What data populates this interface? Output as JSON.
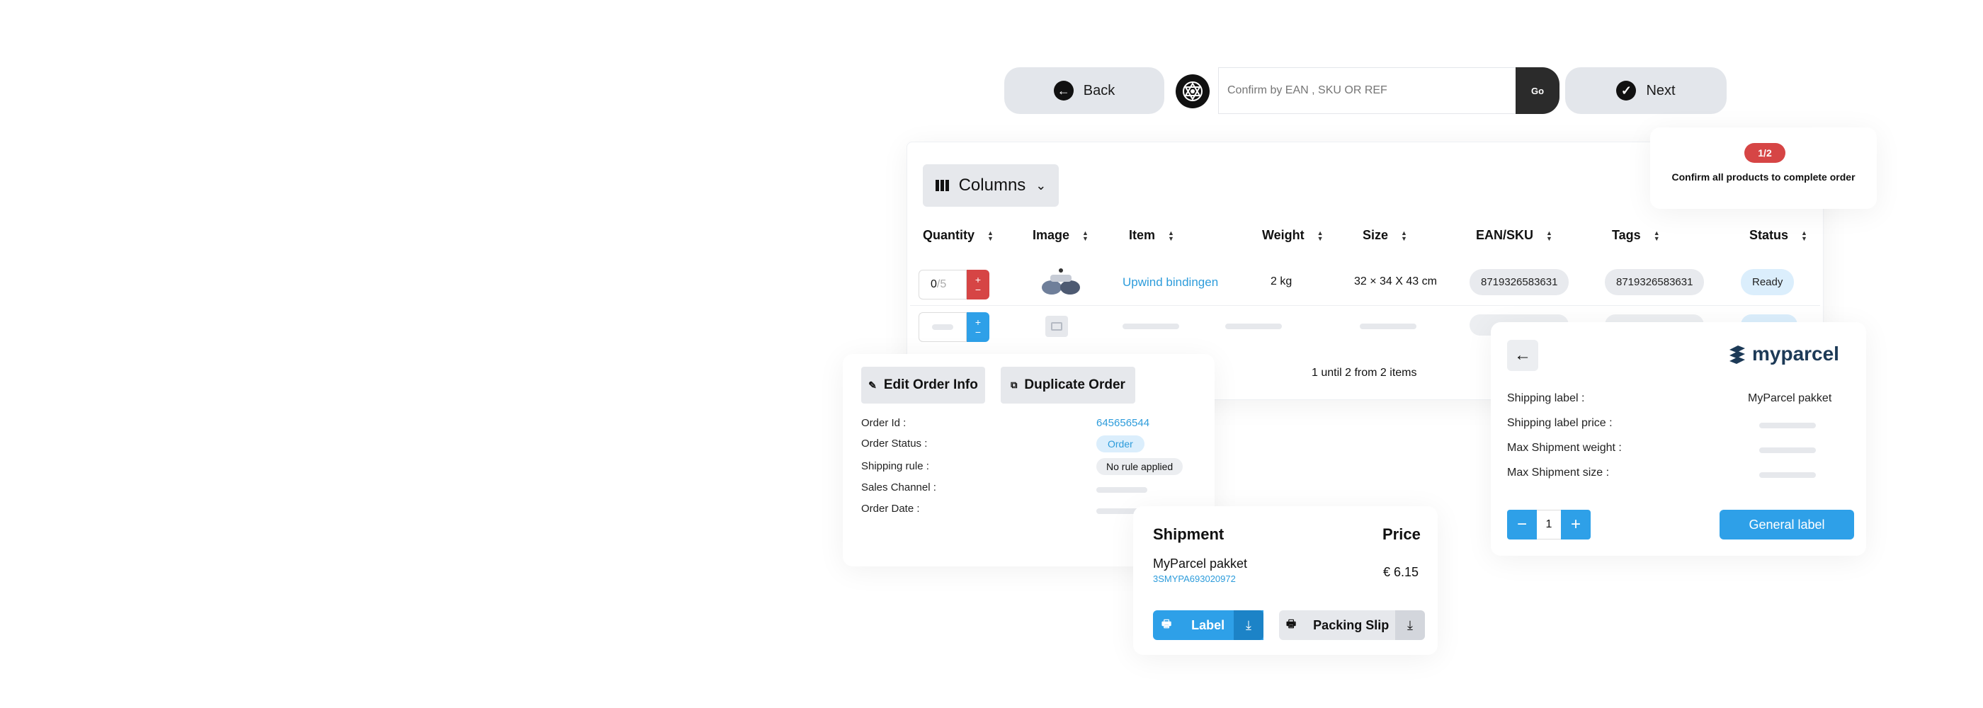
{
  "toolbar": {
    "back_label": "Back",
    "confirm_placeholder": "Confirm by EAN , SKU OR REF",
    "go_label": "Go",
    "next_label": "Next"
  },
  "progress": {
    "badge": "1/2",
    "message": "Confirm all products to complete order"
  },
  "table": {
    "columns_button": "Columns",
    "headers": [
      "Quantity",
      "Image",
      "Item",
      "Weight",
      "Size",
      "EAN/SKU",
      "Tags",
      "Status"
    ],
    "row1": {
      "qty_value": "0",
      "qty_total": "/5",
      "item": "Upwind bindingen",
      "weight": "2 kg",
      "size": "32 × 34 X 43 cm",
      "ean": "8719326583631",
      "tags": "8719326583631",
      "status": "Ready"
    },
    "pagination": "1 until 2 from 2 items"
  },
  "order": {
    "edit_button": "Edit Order Info",
    "duplicate_button": "Duplicate Order",
    "fields": {
      "order_id_label": "Order Id :",
      "order_id_value": "645656544",
      "status_label": "Order Status :",
      "status_value": "Order",
      "shipping_rule_label": "Shipping rule  :",
      "shipping_rule_value": "No rule applied",
      "sales_channel_label": "Sales Channel :",
      "order_date_label": "Order Date :"
    }
  },
  "shipment": {
    "header_shipment": "Shipment",
    "header_price": "Price",
    "carrier": "MyParcel pakket",
    "tracking": "3SMYPA693020972",
    "price": "€ 6.15",
    "label_button": "Label",
    "packing_slip_button": "Packing Slip"
  },
  "myparcel": {
    "logo_text": "myparcel",
    "shipping_label_label": "Shipping label :",
    "shipping_label_value": "MyParcel pakket",
    "price_label": "Shipping label price :",
    "max_weight_label": "Max Shipment weight :",
    "max_size_label": "Max Shipment size :",
    "quantity": "1",
    "generate_button": "General label",
    "logo_color": "#1d3a57"
  },
  "colors": {
    "accent": "#2ea0e8",
    "danger": "#d64545",
    "dark": "#222222"
  }
}
